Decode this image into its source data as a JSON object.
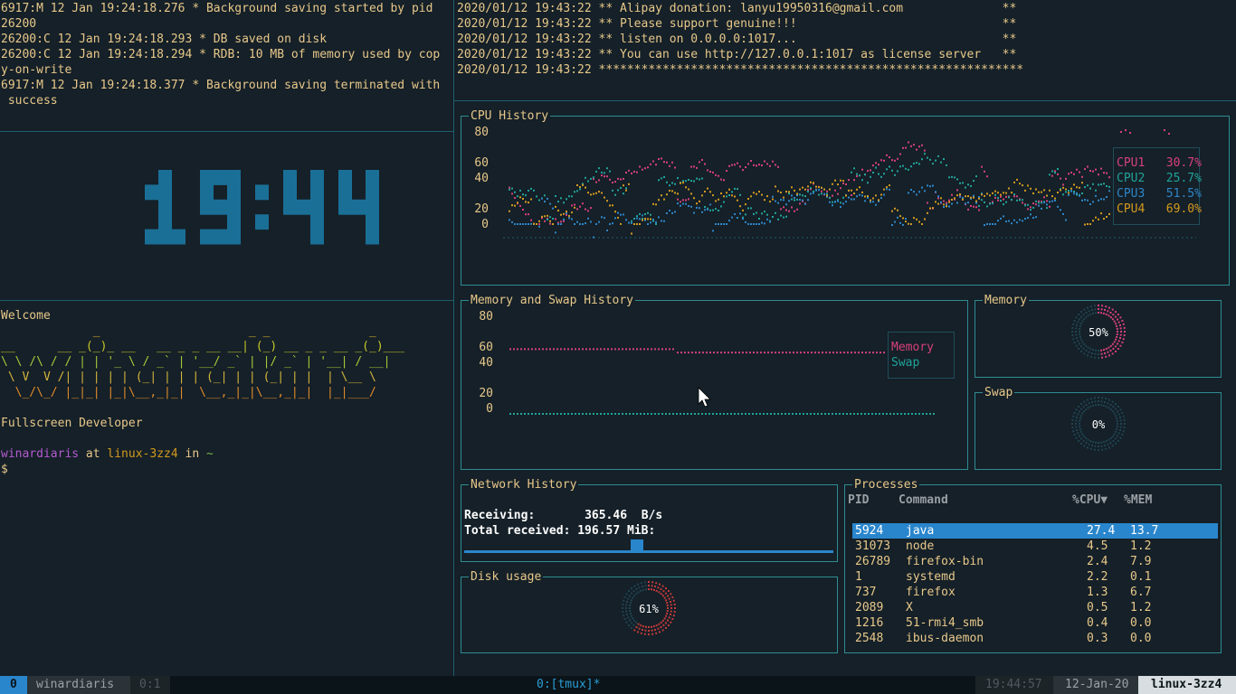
{
  "colors": {
    "bg": "#152028",
    "text": "#e8c88a",
    "border": "#2f8c92",
    "clock": "#1a6f97",
    "cpu1": "#d6407c",
    "cpu2": "#22a39a",
    "cpu3": "#2e86c8",
    "cpu4": "#d49a1f",
    "selection": "#2a86cc"
  },
  "redis_log": [
    "6917:M 12 Jan 19:24:18.276 * Background saving started by pid",
    "26200",
    "26200:C 12 Jan 19:24:18.293 * DB saved on disk",
    "26200:C 12 Jan 19:24:18.294 * RDB: 10 MB of memory used by cop",
    "y-on-write",
    "6917:M 12 Jan 19:24:18.377 * Background saving terminated with",
    " success"
  ],
  "license_log": [
    "2020/01/12 19:43:22 ** Alipay donation: lanyu19950316@gmail.com              **",
    "2020/01/12 19:43:22 ** Please support genuine!!!                             **",
    "2020/01/12 19:43:22 ** listen on 0.0.0.0:1017...                             **",
    "2020/01/12 19:43:22 ** You can use http://127.0.0.1:1017 as license server   **",
    "2020/01/12 19:43:22 ************************************************************"
  ],
  "clock": {
    "time": "19:44"
  },
  "shell": {
    "welcome": "Welcome",
    "ascii_art": [
      "             _                     _ _              _",
      "__      __ _(_)_ __   __ _ _ __ __| (_) __ _ _ __ _(_)___",
      "\\ \\ /\\ / / | | '_ \\ / _` | '__/ _` | |/ _` | '__| / __|",
      " \\ V  V /| | | | | (_| | | | (_| | | (_| | |  | \\__ \\",
      "  \\_/\\_/ |_|_| |_|\\__,_|_|  \\__,_|_|\\__,_|_|  |_|___/"
    ],
    "subtitle": "Fullscreen Developer",
    "prompt_user": "winardiaris",
    "prompt_at": " at ",
    "prompt_host": "linux-3zz4",
    "prompt_in": " in ",
    "prompt_dir": "~",
    "prompt_symbol": "$"
  },
  "cpu_history": {
    "title": "CPU History",
    "yticks": [
      "80",
      "60",
      "40",
      "20",
      "0"
    ],
    "legend": [
      {
        "label": "CPU1",
        "value": "30.7%",
        "color": "#d6407c"
      },
      {
        "label": "CPU2",
        "value": "25.7%",
        "color": "#22a39a"
      },
      {
        "label": "CPU3",
        "value": "51.5%",
        "color": "#2e86c8"
      },
      {
        "label": "CPU4",
        "value": "69.0%",
        "color": "#d49a1f"
      }
    ]
  },
  "memory_history": {
    "title": "Memory and Swap History",
    "yticks": [
      "80",
      "60",
      "40",
      "20",
      "0"
    ],
    "legend": [
      {
        "label": "Memory",
        "color": "#d6407c"
      },
      {
        "label": "Swap",
        "color": "#22a39a"
      }
    ]
  },
  "memory_gauge": {
    "title": "Memory",
    "label": "50%",
    "percent": 50
  },
  "swap_gauge": {
    "title": "Swap",
    "label": "0%",
    "percent": 0
  },
  "network": {
    "title": "Network History",
    "receiving_label": "Receiving:",
    "receiving_value": "365.46  B/s",
    "total_label": "Total received:",
    "total_value": "196.57 MiB:"
  },
  "disk": {
    "title": "Disk usage",
    "label": "61%",
    "percent": 61
  },
  "processes": {
    "title": "Processes",
    "headers": {
      "pid": "PID",
      "command": "Command",
      "cpu": "%CPU▼",
      "mem": "%MEM"
    },
    "rows": [
      {
        "pid": "5924",
        "command": "java",
        "cpu": "27.4",
        "mem": "13.7",
        "selected": true
      },
      {
        "pid": "31073",
        "command": "node",
        "cpu": "4.5",
        "mem": "1.2"
      },
      {
        "pid": "26789",
        "command": "firefox-bin",
        "cpu": "2.4",
        "mem": "7.9"
      },
      {
        "pid": "1",
        "command": "systemd",
        "cpu": "2.2",
        "mem": "0.1"
      },
      {
        "pid": "737",
        "command": "firefox",
        "cpu": "1.3",
        "mem": "6.7"
      },
      {
        "pid": "2089",
        "command": "X",
        "cpu": "0.5",
        "mem": "1.2"
      },
      {
        "pid": "1216",
        "command": "51-rmi4_smb",
        "cpu": "0.4",
        "mem": "0.0"
      },
      {
        "pid": "2548",
        "command": "ibus-daemon",
        "cpu": "0.3",
        "mem": "0.0"
      }
    ]
  },
  "statusbar": {
    "session_index": "0",
    "session_name": "winardiaris",
    "window_left": "0:1",
    "window_center": "0:[tmux]*",
    "time": "19:44:57",
    "date": "12-Jan-20",
    "host": "linux-3zz4"
  }
}
